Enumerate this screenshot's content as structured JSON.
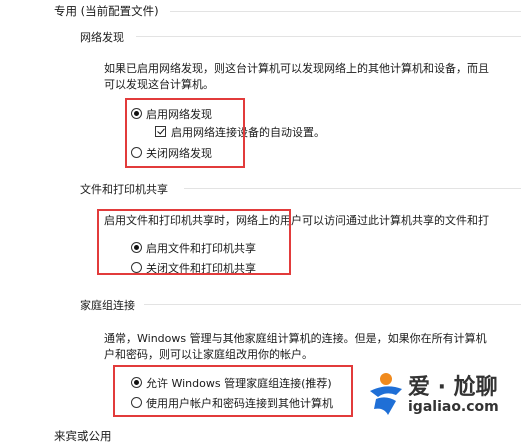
{
  "section": {
    "title": "专用 (当前配置文件)"
  },
  "network_discovery": {
    "heading": "网络发现",
    "desc_line1": "如果已启用网络发现，则这台计算机可以发现网络上的其他计算机和设备，而且",
    "desc_line2": "可以发现这台计算机。",
    "options": [
      {
        "label": "启用网络发现",
        "selected": true
      },
      {
        "label": "关闭网络发现",
        "selected": false
      }
    ],
    "auto_setup": {
      "label": "启用网络连接设备的自动设置。",
      "checked": true
    }
  },
  "file_sharing": {
    "heading": "文件和打印机共享",
    "desc_line1": "启用文件和打印机共享时，网络上的用户可以访问通过此计算机共享的文件和打",
    "options": [
      {
        "label": "启用文件和打印机共享",
        "selected": true
      },
      {
        "label": "关闭文件和打印机共享",
        "selected": false
      }
    ]
  },
  "homegroup": {
    "heading": "家庭组连接",
    "desc_line1": "通常，Windows 管理与其他家庭组计算机的连接。但是，如果你在所有计算机",
    "desc_line2": "户和密码，则可以让家庭组改用你的帐户。",
    "options": [
      {
        "label": "允许 Windows 管理家庭组连接(推荐)",
        "selected": true
      },
      {
        "label": "使用用户帐户和密码连接到其他计算机",
        "selected": false
      }
    ]
  },
  "next_section": {
    "title": "来宾或公用"
  },
  "watermark": {
    "line1": "爱 · 尬聊",
    "line2": "igaliao.com",
    "logo_icon": "igaliao-logo-icon"
  },
  "colors": {
    "highlight_box": "#e23b3b",
    "watermark_blue": "#1f6fd6",
    "watermark_orange": "#f08a1d"
  }
}
